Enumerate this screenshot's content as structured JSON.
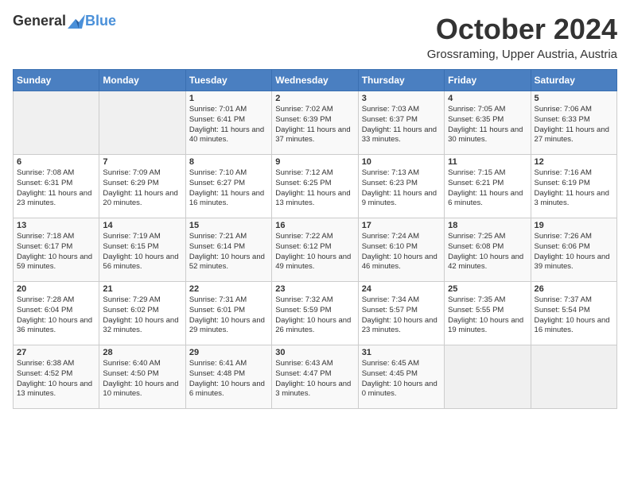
{
  "header": {
    "logo_general": "General",
    "logo_blue": "Blue",
    "month_title": "October 2024",
    "location": "Grossraming, Upper Austria, Austria"
  },
  "weekdays": [
    "Sunday",
    "Monday",
    "Tuesday",
    "Wednesday",
    "Thursday",
    "Friday",
    "Saturday"
  ],
  "weeks": [
    [
      {
        "day": "",
        "content": ""
      },
      {
        "day": "",
        "content": ""
      },
      {
        "day": "1",
        "content": "Sunrise: 7:01 AM\nSunset: 6:41 PM\nDaylight: 11 hours and 40 minutes."
      },
      {
        "day": "2",
        "content": "Sunrise: 7:02 AM\nSunset: 6:39 PM\nDaylight: 11 hours and 37 minutes."
      },
      {
        "day": "3",
        "content": "Sunrise: 7:03 AM\nSunset: 6:37 PM\nDaylight: 11 hours and 33 minutes."
      },
      {
        "day": "4",
        "content": "Sunrise: 7:05 AM\nSunset: 6:35 PM\nDaylight: 11 hours and 30 minutes."
      },
      {
        "day": "5",
        "content": "Sunrise: 7:06 AM\nSunset: 6:33 PM\nDaylight: 11 hours and 27 minutes."
      }
    ],
    [
      {
        "day": "6",
        "content": "Sunrise: 7:08 AM\nSunset: 6:31 PM\nDaylight: 11 hours and 23 minutes."
      },
      {
        "day": "7",
        "content": "Sunrise: 7:09 AM\nSunset: 6:29 PM\nDaylight: 11 hours and 20 minutes."
      },
      {
        "day": "8",
        "content": "Sunrise: 7:10 AM\nSunset: 6:27 PM\nDaylight: 11 hours and 16 minutes."
      },
      {
        "day": "9",
        "content": "Sunrise: 7:12 AM\nSunset: 6:25 PM\nDaylight: 11 hours and 13 minutes."
      },
      {
        "day": "10",
        "content": "Sunrise: 7:13 AM\nSunset: 6:23 PM\nDaylight: 11 hours and 9 minutes."
      },
      {
        "day": "11",
        "content": "Sunrise: 7:15 AM\nSunset: 6:21 PM\nDaylight: 11 hours and 6 minutes."
      },
      {
        "day": "12",
        "content": "Sunrise: 7:16 AM\nSunset: 6:19 PM\nDaylight: 11 hours and 3 minutes."
      }
    ],
    [
      {
        "day": "13",
        "content": "Sunrise: 7:18 AM\nSunset: 6:17 PM\nDaylight: 10 hours and 59 minutes."
      },
      {
        "day": "14",
        "content": "Sunrise: 7:19 AM\nSunset: 6:15 PM\nDaylight: 10 hours and 56 minutes."
      },
      {
        "day": "15",
        "content": "Sunrise: 7:21 AM\nSunset: 6:14 PM\nDaylight: 10 hours and 52 minutes."
      },
      {
        "day": "16",
        "content": "Sunrise: 7:22 AM\nSunset: 6:12 PM\nDaylight: 10 hours and 49 minutes."
      },
      {
        "day": "17",
        "content": "Sunrise: 7:24 AM\nSunset: 6:10 PM\nDaylight: 10 hours and 46 minutes."
      },
      {
        "day": "18",
        "content": "Sunrise: 7:25 AM\nSunset: 6:08 PM\nDaylight: 10 hours and 42 minutes."
      },
      {
        "day": "19",
        "content": "Sunrise: 7:26 AM\nSunset: 6:06 PM\nDaylight: 10 hours and 39 minutes."
      }
    ],
    [
      {
        "day": "20",
        "content": "Sunrise: 7:28 AM\nSunset: 6:04 PM\nDaylight: 10 hours and 36 minutes."
      },
      {
        "day": "21",
        "content": "Sunrise: 7:29 AM\nSunset: 6:02 PM\nDaylight: 10 hours and 32 minutes."
      },
      {
        "day": "22",
        "content": "Sunrise: 7:31 AM\nSunset: 6:01 PM\nDaylight: 10 hours and 29 minutes."
      },
      {
        "day": "23",
        "content": "Sunrise: 7:32 AM\nSunset: 5:59 PM\nDaylight: 10 hours and 26 minutes."
      },
      {
        "day": "24",
        "content": "Sunrise: 7:34 AM\nSunset: 5:57 PM\nDaylight: 10 hours and 23 minutes."
      },
      {
        "day": "25",
        "content": "Sunrise: 7:35 AM\nSunset: 5:55 PM\nDaylight: 10 hours and 19 minutes."
      },
      {
        "day": "26",
        "content": "Sunrise: 7:37 AM\nSunset: 5:54 PM\nDaylight: 10 hours and 16 minutes."
      }
    ],
    [
      {
        "day": "27",
        "content": "Sunrise: 6:38 AM\nSunset: 4:52 PM\nDaylight: 10 hours and 13 minutes."
      },
      {
        "day": "28",
        "content": "Sunrise: 6:40 AM\nSunset: 4:50 PM\nDaylight: 10 hours and 10 minutes."
      },
      {
        "day": "29",
        "content": "Sunrise: 6:41 AM\nSunset: 4:48 PM\nDaylight: 10 hours and 6 minutes."
      },
      {
        "day": "30",
        "content": "Sunrise: 6:43 AM\nSunset: 4:47 PM\nDaylight: 10 hours and 3 minutes."
      },
      {
        "day": "31",
        "content": "Sunrise: 6:45 AM\nSunset: 4:45 PM\nDaylight: 10 hours and 0 minutes."
      },
      {
        "day": "",
        "content": ""
      },
      {
        "day": "",
        "content": ""
      }
    ]
  ]
}
